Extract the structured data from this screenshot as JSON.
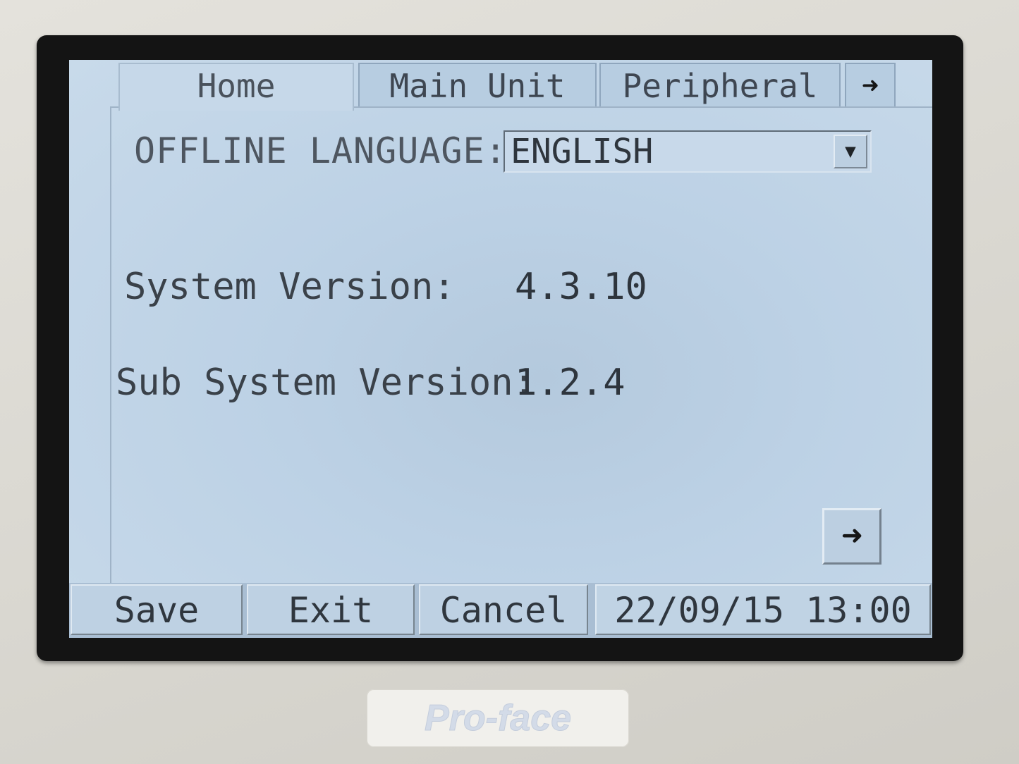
{
  "tabs": [
    {
      "label": "Home",
      "active": true
    },
    {
      "label": "Main Unit",
      "active": false
    },
    {
      "label": "Peripheral",
      "active": false
    }
  ],
  "tab_scroll_icon": "arrow-right-icon",
  "settings": {
    "language_label": "OFFLINE LANGUAGE:",
    "language_value": "ENGLISH",
    "system_version_label": "System Version:",
    "system_version_value": "4.3.10",
    "sub_system_version_label": "Sub System Version:",
    "sub_system_version_value": "1.2.4"
  },
  "next_page_icon": "arrow-right-icon",
  "footer": {
    "save_label": "Save",
    "exit_label": "Exit",
    "cancel_label": "Cancel",
    "datetime": "22/09/15 13:00"
  },
  "brand": {
    "logo_text": "Pro-face"
  },
  "colors": {
    "screen_background": "#bcd1e5",
    "bezel": "#141414",
    "text": "#2e353d"
  }
}
